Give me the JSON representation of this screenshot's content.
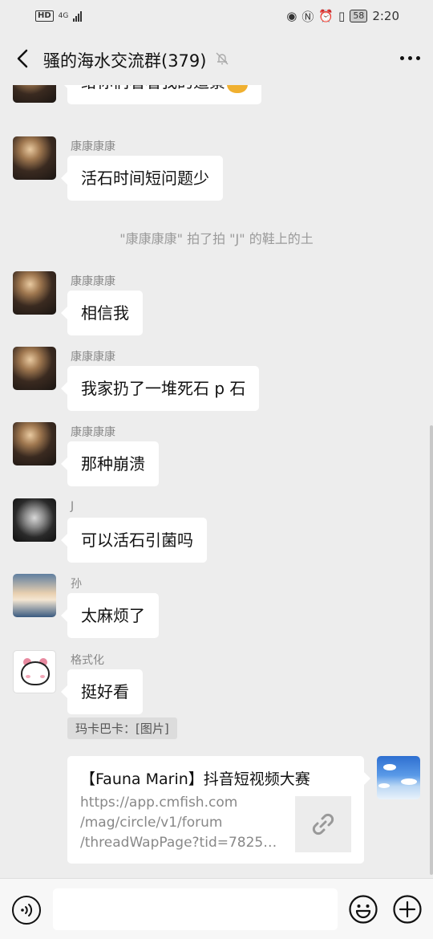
{
  "statusbar": {
    "hd": "HD",
    "network": "4G",
    "battery": "58",
    "time": "2:20"
  },
  "header": {
    "title": "骚的海水交流群(379)"
  },
  "messages": [
    {
      "sender": "",
      "text": "给你们看看我的造景",
      "emoji": "doge-emoji"
    },
    {
      "sender": "康康康康",
      "text": "活石时间短问题少"
    },
    {
      "sender": "康康康康",
      "text": "相信我"
    },
    {
      "sender": "康康康康",
      "text": "我家扔了一堆死石 p 石"
    },
    {
      "sender": "康康康康",
      "text": "那种崩溃"
    },
    {
      "sender": "J",
      "text": "可以活石引菌吗"
    },
    {
      "sender": "孙",
      "text": "太麻烦了"
    },
    {
      "sender": "格式化",
      "text": "挺好看"
    }
  ],
  "system_note": "\"康康康康\" 拍了拍 \"J\" 的鞋上的土",
  "quote": "玛卡巴卡：[图片]",
  "link_card": {
    "title": "【Fauna Marin】抖音短视频大赛",
    "url_line1": "https://app.cmfish.com",
    "url_line2": "/mag/circle/v1/forum",
    "url_line3": "/threadWapPage?tid=78256..."
  },
  "input": {
    "placeholder": ""
  },
  "colors": {
    "background": "#ededed",
    "bubble": "#ffffff",
    "system_text": "#9a9a9a"
  }
}
